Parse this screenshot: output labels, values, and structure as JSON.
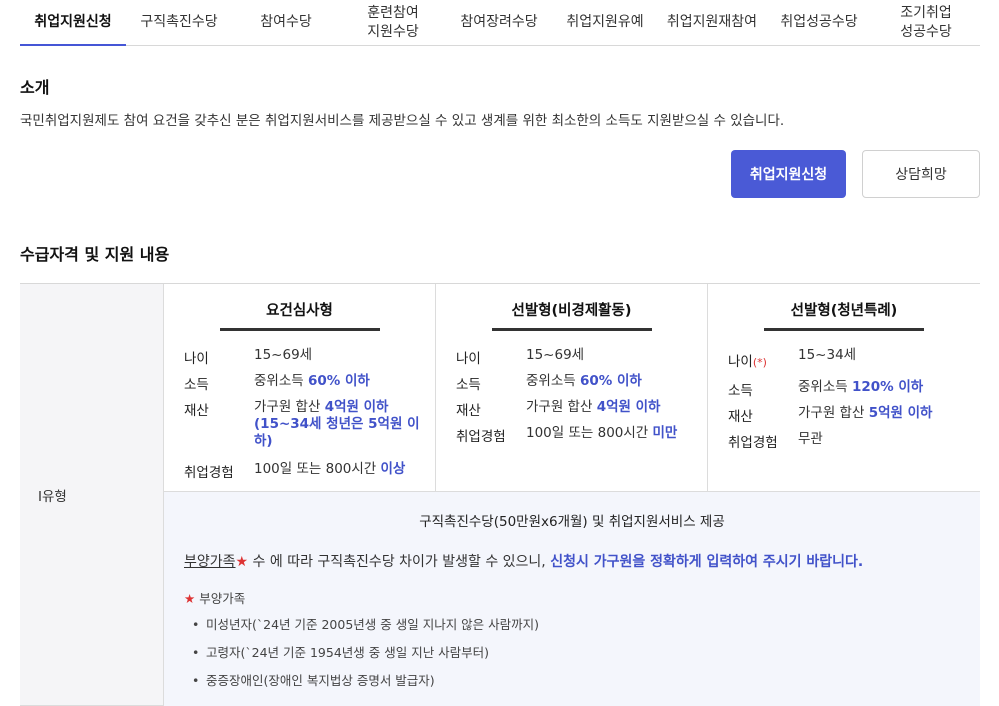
{
  "tabs": [
    {
      "label": "취업지원신청",
      "active": true
    },
    {
      "label": "구직촉진수당",
      "active": false
    },
    {
      "label": "참여수당",
      "active": false
    },
    {
      "label": "훈련참여\n지원수당",
      "active": false
    },
    {
      "label": "참여장려수당",
      "active": false
    },
    {
      "label": "취업지원유예",
      "active": false
    },
    {
      "label": "취업지원재참여",
      "active": false
    },
    {
      "label": "취업성공수당",
      "active": false
    },
    {
      "label": "조기취업\n성공수당",
      "active": false
    }
  ],
  "intro": {
    "title": "소개",
    "text": "국민취업지원제도 참여 요건을 갖추신 분은 취업지원서비스를 제공받으실 수 있고 생계를 위한 최소한의 소득도 지원받으실 수 있습니다."
  },
  "buttons": {
    "apply": "취업지원신청",
    "consult": "상담희망"
  },
  "section_title": "수급자격 및 지원 내용",
  "table": {
    "row_label": "I유형",
    "columns": [
      {
        "title": "요건심사형",
        "rows": [
          {
            "key": "나이",
            "value": "15~69세",
            "hl": ""
          },
          {
            "key": "소득",
            "value": "중위소득 ",
            "hl": "60% 이하"
          },
          {
            "key": "재산",
            "value": "가구원 합산 ",
            "hl": "4억원 이하",
            "hl2": "(15~34세 청년은 5억원 이하)"
          },
          {
            "key": "취업경험",
            "value": "100일 또는 800시간 ",
            "hl": "이상"
          }
        ]
      },
      {
        "title": "선발형(비경제활동)",
        "rows": [
          {
            "key": "나이",
            "value": "15~69세",
            "hl": ""
          },
          {
            "key": "소득",
            "value": "중위소득 ",
            "hl": "60% 이하"
          },
          {
            "key": "재산",
            "value": "가구원 합산 ",
            "hl": "4억원 이하"
          },
          {
            "key": "취업경험",
            "value": "100일 또는 800시간 ",
            "hl": "미만"
          }
        ]
      },
      {
        "title": "선발형(청년특례)",
        "rows": [
          {
            "key": "나이",
            "key_mark": "(*)",
            "value": "15~34세",
            "hl": ""
          },
          {
            "key": "소득",
            "value": "중위소득 ",
            "hl": "120% 이하"
          },
          {
            "key": "재산",
            "value": "가구원 합산 ",
            "hl": "5억원 이하"
          },
          {
            "key": "취업경험",
            "value": "무관",
            "hl": ""
          }
        ]
      }
    ],
    "bottom": {
      "title": "구직촉진수당(50만원x6개월) 및 취업지원서비스 제공",
      "note_link": "부양가족",
      "note_star": "★",
      "note_text": " 수 에 따라 구직촉진수당 차이가 발생할 수 있으니, ",
      "note_hl": "신청시 가구원을 정확하게 입력하여 주시기 바랍니다.",
      "sub_star": "★",
      "sub_title": " 부양가족",
      "items": [
        "미성년자(`24년 기준 2005년생 중 생일 지나지 않은 사람까지)",
        "고령자(`24년 기준 1954년생 중 생일 지난 사람부터)",
        "중증장애인(장애인 복지법상 증명서 발급자)"
      ]
    }
  },
  "colors": {
    "accent": "#4a5ad6",
    "highlight": "#4152c9",
    "star": "#dd3333",
    "bottom_bg": "#f4f6fc",
    "row_head_bg": "#f5f5f7"
  }
}
